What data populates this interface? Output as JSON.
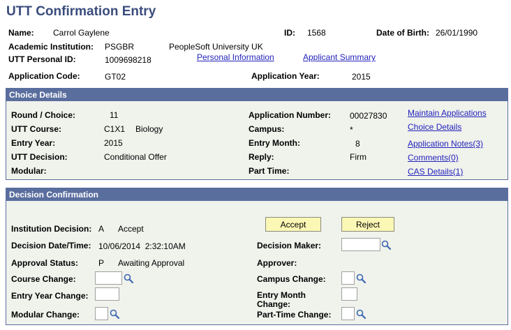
{
  "page_title": "UTT Confirmation Entry",
  "header": {
    "name_label": "Name:",
    "name_value": "Carrol Gaylene",
    "id_label": "ID:",
    "id_value": "1568",
    "dob_label": "Date of Birth:",
    "dob_value": "26/01/1990",
    "institution_label": "Academic Institution:",
    "institution_code": "PSGBR",
    "institution_name": "PeopleSoft University UK",
    "personal_id_label": "UTT Personal ID:",
    "personal_id_value": "1009698218",
    "personal_info_link": "Personal Information",
    "applicant_summary_link": "Applicant Summary",
    "application_code_label": "Application Code:",
    "application_code_value": "GT02",
    "application_year_label": "Application Year:",
    "application_year_value": "2015"
  },
  "choice_details": {
    "header": "Choice Details",
    "round_label": "Round / Choice:",
    "round_value": "11",
    "course_label": "UTT Course:",
    "course_code": "C1X1",
    "course_name": "Biology",
    "entry_year_label": "Entry Year:",
    "entry_year_value": "2015",
    "decision_label": "UTT Decision:",
    "decision_value": "Conditional Offer",
    "modular_label": "Modular:",
    "app_number_label": "Application Number:",
    "app_number_value": "00027830",
    "campus_label": "Campus:",
    "campus_value": "*",
    "entry_month_label": "Entry Month:",
    "entry_month_value": "8",
    "reply_label": "Reply:",
    "reply_value": "Firm",
    "part_time_label": "Part Time:",
    "links": {
      "maintain": "Maintain Applications",
      "choice": "Choice Details",
      "notes": "Application Notes(3)",
      "comments": "Comments(0)",
      "cas": "CAS Details(1)"
    }
  },
  "decision_confirmation": {
    "header": "Decision Confirmation",
    "accept_label": "Accept",
    "reject_label": "Reject",
    "inst_decision_label": "Institution Decision:",
    "inst_decision_code": "A",
    "inst_decision_text": "Accept",
    "decision_datetime_label": "Decision Date/Time:",
    "decision_datetime_value": "10/06/2014  2:32:10AM",
    "decision_maker_label": "Decision Maker:",
    "approval_status_label": "Approval Status:",
    "approval_status_code": "P",
    "approval_status_text": "Awaiting Approval",
    "approver_label": "Approver:",
    "course_change_label": "Course Change:",
    "campus_change_label": "Campus Change:",
    "entry_year_change_label": "Entry Year Change:",
    "entry_month_change_label": "Entry Month Change:",
    "modular_change_label": "Modular Change:",
    "part_time_change_label": "Part-Time Change:"
  },
  "icons": {
    "lookup": "magnifier-icon"
  },
  "colors": {
    "title": "#3a4c7c",
    "section_header": "#5a6e9e",
    "section_bg": "#f0f2ec",
    "button": "#fbf7b4",
    "link": "#2222bb"
  }
}
